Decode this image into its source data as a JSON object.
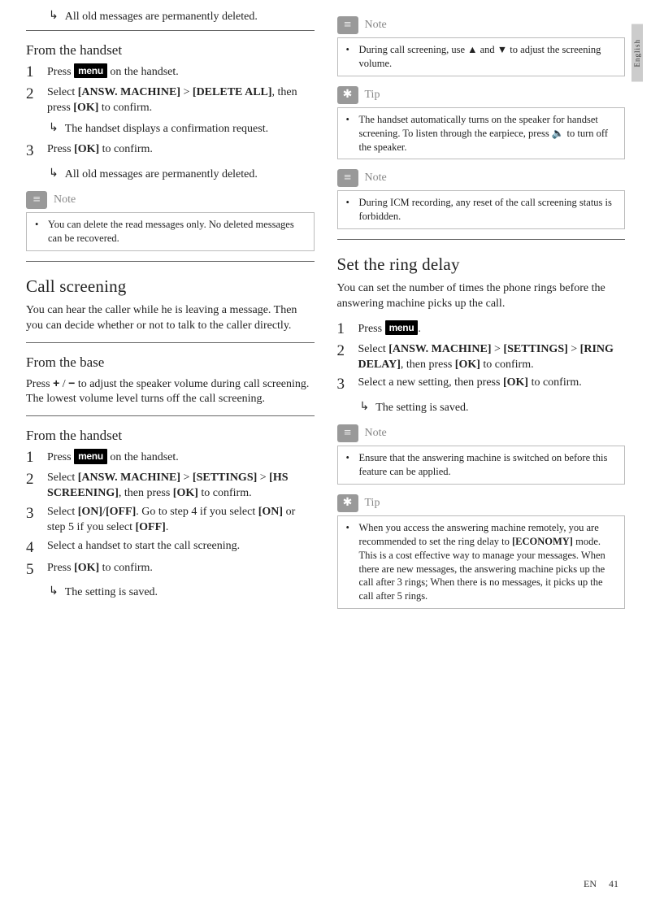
{
  "lang_tab": "English",
  "left": {
    "intro_arrow": "All old messages are permanently deleted.",
    "sec1": {
      "title": "From the handset",
      "steps": [
        {
          "n": "1",
          "pre": "Press ",
          "menu": "menu",
          "post": " on the handset."
        },
        {
          "n": "2",
          "txt": "Select [ANSW. MACHINE] > [DELETE ALL], then press [OK] to confirm.",
          "arrow": "The handset displays a confirmation request."
        },
        {
          "n": "3",
          "txt": "Press [OK] to confirm.",
          "arrow": "All old messages are permanently deleted."
        }
      ],
      "note_label": "Note",
      "note": "You can delete the read messages only. No deleted messages can be recovered."
    },
    "sec2": {
      "title": "Call screening",
      "body": "You can hear the caller while he is leaving a message. Then you can decide whether or not to talk to the caller directly."
    },
    "sec3": {
      "title": "From the base",
      "body": "Press + / − to adjust the speaker volume during call screening. The lowest volume level turns off the call screening."
    },
    "sec4": {
      "title": "From the handset",
      "steps": [
        {
          "n": "1",
          "pre": "Press ",
          "menu": "menu",
          "post": " on the handset."
        },
        {
          "n": "2",
          "txt": "Select [ANSW. MACHINE] > [SETTINGS] > [HS SCREENING], then press [OK] to confirm."
        },
        {
          "n": "3",
          "txt": "Select [ON]/[OFF]. Go to step 4 if you select [ON] or step 5 if you select [OFF]."
        },
        {
          "n": "4",
          "txt": "Select a handset to start the call screening."
        },
        {
          "n": "5",
          "txt": "Press [OK] to confirm.",
          "arrow": "The setting is saved."
        }
      ]
    }
  },
  "right": {
    "note1_label": "Note",
    "note1": "During call screening, use ▲ and ▼ to adjust the screening volume.",
    "tip1_label": "Tip",
    "tip1": "The handset automatically turns on the speaker for handset screening. To listen through the earpiece, press 🔈 to turn off the speaker.",
    "note2_label": "Note",
    "note2": "During ICM recording, any reset of the call screening status is forbidden.",
    "sec1": {
      "title": "Set the ring delay",
      "body": "You can set the number of times the phone rings before the answering machine picks up the call.",
      "steps": [
        {
          "n": "1",
          "pre": "Press ",
          "menu": "menu",
          "post": "."
        },
        {
          "n": "2",
          "txt": "Select [ANSW. MACHINE] > [SETTINGS] > [RING DELAY], then press [OK] to confirm."
        },
        {
          "n": "3",
          "txt": "Select a new setting, then press [OK] to confirm.",
          "arrow": "The setting is saved."
        }
      ],
      "note_label": "Note",
      "note": "Ensure that the answering machine is switched on before this feature can be applied.",
      "tip_label": "Tip",
      "tip": "When you access the answering machine remotely, you are recommended to set the ring delay to [ECONOMY] mode. This is a cost effective way to manage your messages. When there are new messages, the answering machine picks up the call after 3 rings; When there is no messages, it picks up the call after 5 rings."
    }
  },
  "footer_lang": "EN",
  "footer_page": "41"
}
